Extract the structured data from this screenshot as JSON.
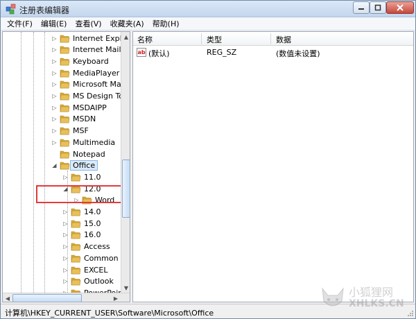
{
  "window": {
    "title": "注册表编辑器"
  },
  "menu": [
    "文件(F)",
    "编辑(E)",
    "查看(V)",
    "收藏夹(A)",
    "帮助(H)"
  ],
  "tree": {
    "items": [
      {
        "label": "Internet Explor",
        "level": 0,
        "expander": "collapsed"
      },
      {
        "label": "Internet Mail a",
        "level": 0,
        "expander": "collapsed"
      },
      {
        "label": "Keyboard",
        "level": 0,
        "expander": "collapsed"
      },
      {
        "label": "MediaPlayer",
        "level": 0,
        "expander": "collapsed"
      },
      {
        "label": "Microsoft Mar",
        "level": 0,
        "expander": "collapsed"
      },
      {
        "label": "MS Design Toc",
        "level": 0,
        "expander": "collapsed"
      },
      {
        "label": "MSDAIPP",
        "level": 0,
        "expander": "collapsed"
      },
      {
        "label": "MSDN",
        "level": 0,
        "expander": "collapsed"
      },
      {
        "label": "MSF",
        "level": 0,
        "expander": "collapsed"
      },
      {
        "label": "Multimedia",
        "level": 0,
        "expander": "collapsed"
      },
      {
        "label": "Notepad",
        "level": 0,
        "expander": "none"
      },
      {
        "label": "Office",
        "level": 0,
        "expander": "expanded",
        "selected": true
      },
      {
        "label": "11.0",
        "level": 1,
        "expander": "collapsed"
      },
      {
        "label": "12.0",
        "level": 1,
        "expander": "expanded"
      },
      {
        "label": "Word",
        "level": 2,
        "expander": "collapsed"
      },
      {
        "label": "14.0",
        "level": 1,
        "expander": "collapsed"
      },
      {
        "label": "15.0",
        "level": 1,
        "expander": "collapsed"
      },
      {
        "label": "16.0",
        "level": 1,
        "expander": "collapsed"
      },
      {
        "label": "Access",
        "level": 1,
        "expander": "collapsed"
      },
      {
        "label": "Common",
        "level": 1,
        "expander": "collapsed"
      },
      {
        "label": "EXCEL",
        "level": 1,
        "expander": "collapsed"
      },
      {
        "label": "Outlook",
        "level": 1,
        "expander": "collapsed"
      },
      {
        "label": "PowerPoint",
        "level": 1,
        "expander": "collapsed"
      }
    ]
  },
  "list": {
    "columns": [
      "名称",
      "类型",
      "数据"
    ],
    "rows": [
      {
        "name": "(默认)",
        "type": "REG_SZ",
        "data": "(数值未设置)"
      }
    ]
  },
  "status": {
    "path": "计算机\\HKEY_CURRENT_USER\\Software\\Microsoft\\Office"
  },
  "watermark": {
    "cn": "小狐狸网",
    "en": "XHLKS.CN"
  },
  "colors": {
    "highlight": "#e33a3a",
    "folder": "#e8c05a",
    "selection": "#dbeaf9"
  }
}
